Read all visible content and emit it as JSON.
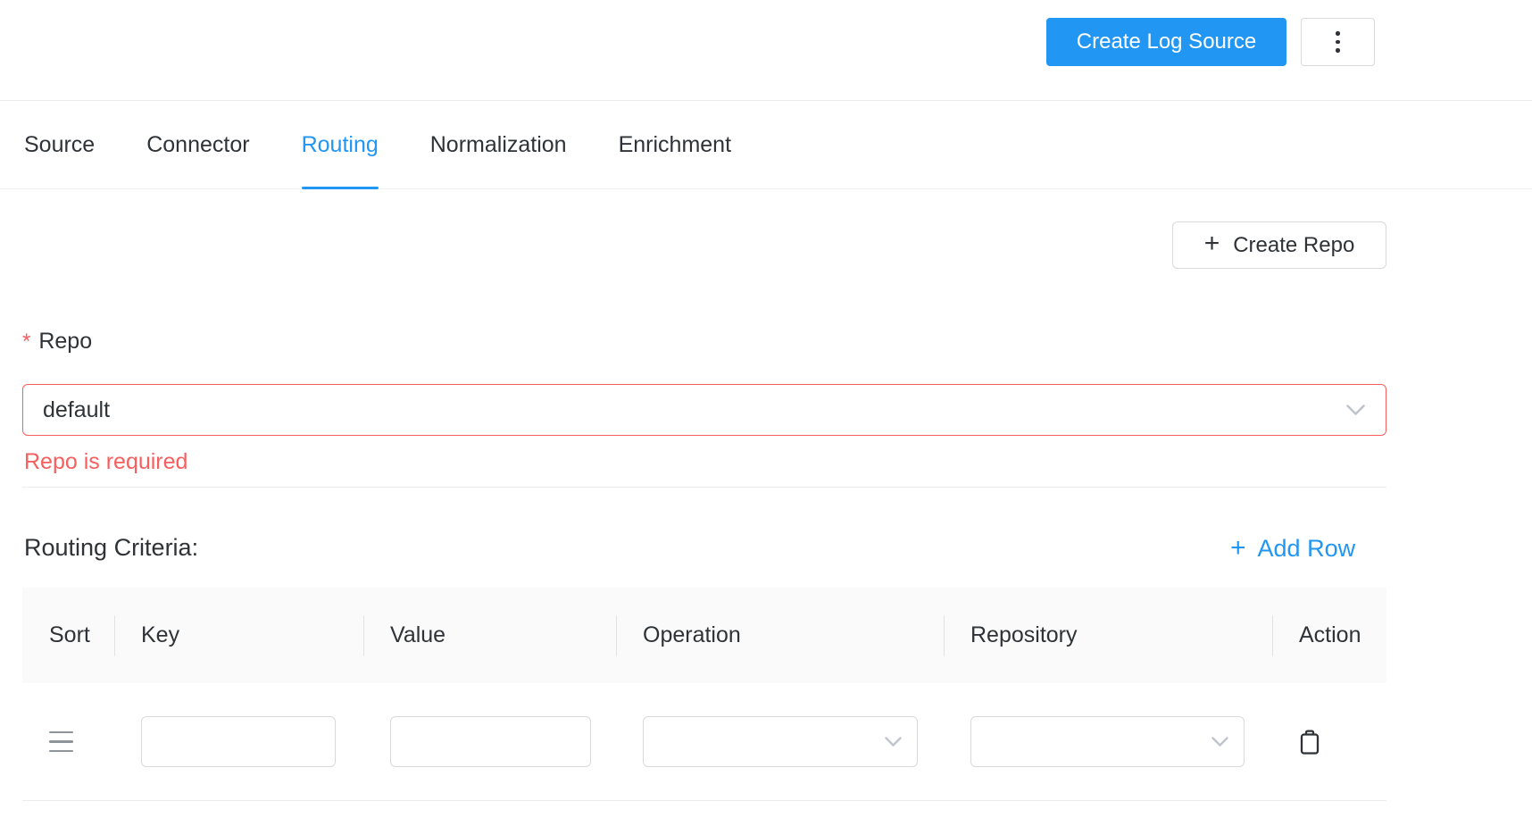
{
  "header": {
    "create_log_source_label": "Create Log Source"
  },
  "tabs": {
    "active": "Routing",
    "items": [
      {
        "label": "Source"
      },
      {
        "label": "Connector"
      },
      {
        "label": "Routing"
      },
      {
        "label": "Normalization"
      },
      {
        "label": "Enrichment"
      }
    ]
  },
  "routing": {
    "create_repo": {
      "plus": "+",
      "label": "Create Repo"
    },
    "repo_field": {
      "required_marker": "*",
      "label": "Repo",
      "value": "default",
      "error": "Repo is required"
    },
    "criteria": {
      "title": "Routing Criteria:",
      "add_row": {
        "plus": "+",
        "label": "Add Row"
      },
      "table": {
        "columns": [
          {
            "label": "Sort"
          },
          {
            "label": "Key"
          },
          {
            "label": "Value"
          },
          {
            "label": "Operation"
          },
          {
            "label": "Repository"
          },
          {
            "label": "Action"
          }
        ],
        "rows": [
          {
            "key": "",
            "value": "",
            "operation": "",
            "repository": ""
          }
        ]
      }
    }
  },
  "icons": {
    "more_menu": "kebab-vertical-dots",
    "create_repo_plus": "plus",
    "add_row_plus": "plus",
    "select_chevron": "chevron-down",
    "sort_handle": "drag-hamburger",
    "delete_action": "trash-can"
  },
  "colors": {
    "accent_blue": "#2196f3",
    "error_red": "#f85e5e",
    "text_dark": "#2f3337",
    "border_gray": "#d9d9d9",
    "table_header_bg": "#fafafa"
  }
}
